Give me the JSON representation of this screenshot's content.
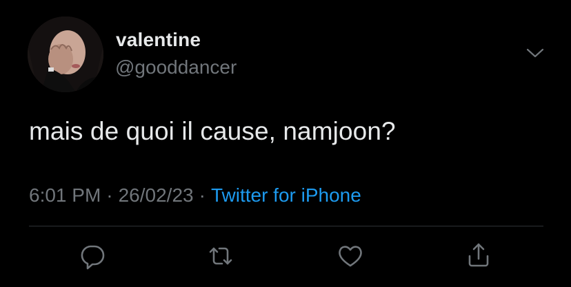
{
  "user": {
    "display_name": "valentine",
    "handle": "@gooddancer"
  },
  "tweet": {
    "text": "mais de quoi il cause, namjoon?",
    "time": "6:01 PM",
    "date": "26/02/23",
    "separator": "·",
    "source": "Twitter for iPhone"
  },
  "actions": {
    "reply_icon": "reply-icon",
    "retweet_icon": "retweet-icon",
    "like_icon": "heart-icon",
    "share_icon": "share-icon"
  },
  "colors": {
    "background": "#000000",
    "text": "#e7e9ea",
    "secondary": "#71767b",
    "accent": "#1d9bf0",
    "divider": "#2f3336"
  }
}
